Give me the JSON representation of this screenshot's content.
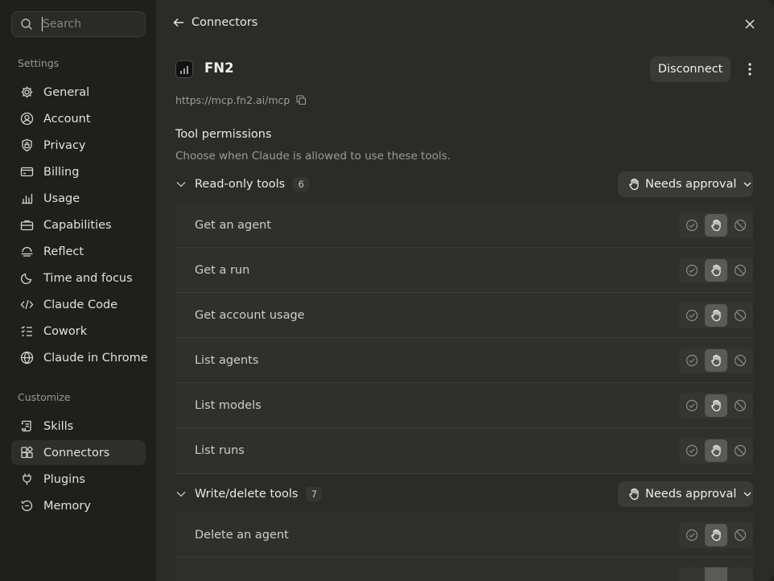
{
  "search": {
    "placeholder": "Search"
  },
  "sidebar": {
    "settings_label": "Settings",
    "settings_items": [
      {
        "label": "General",
        "icon": "gear-icon"
      },
      {
        "label": "Account",
        "icon": "user-icon"
      },
      {
        "label": "Privacy",
        "icon": "lock-shield-icon"
      },
      {
        "label": "Billing",
        "icon": "credit-card-icon"
      },
      {
        "label": "Usage",
        "icon": "bar-chart-icon"
      },
      {
        "label": "Capabilities",
        "icon": "briefcase-icon"
      },
      {
        "label": "Reflect",
        "icon": "reflect-icon"
      },
      {
        "label": "Time and focus",
        "icon": "moon-icon"
      },
      {
        "label": "Claude Code",
        "icon": "code-icon"
      },
      {
        "label": "Cowork",
        "icon": "checklist-icon"
      },
      {
        "label": "Claude in Chrome",
        "icon": "globe-icon"
      }
    ],
    "customize_label": "Customize",
    "customize_items": [
      {
        "label": "Skills",
        "icon": "scroll-icon"
      },
      {
        "label": "Connectors",
        "icon": "connectors-icon",
        "active": true
      },
      {
        "label": "Plugins",
        "icon": "plug-icon"
      },
      {
        "label": "Memory",
        "icon": "memory-icon"
      }
    ]
  },
  "header": {
    "back_label": "Connectors"
  },
  "connector": {
    "name": "FN2",
    "url": "https://mcp.fn2.ai/mcp",
    "disconnect_label": "Disconnect"
  },
  "permissions": {
    "title": "Tool permissions",
    "description": "Choose when Claude is allowed to use these tools.",
    "groups": [
      {
        "name": "Read-only tools",
        "count": "6",
        "approval": "Needs approval",
        "tools": [
          "Get an agent",
          "Get a run",
          "Get account usage",
          "List agents",
          "List models",
          "List runs"
        ]
      },
      {
        "name": "Write/delete tools",
        "count": "7",
        "approval": "Needs approval",
        "tools": [
          "Delete an agent"
        ]
      }
    ]
  },
  "colors": {
    "selected": "#5a5a56",
    "panel": "#2b2b29",
    "sidebar": "#1f1f1d"
  }
}
